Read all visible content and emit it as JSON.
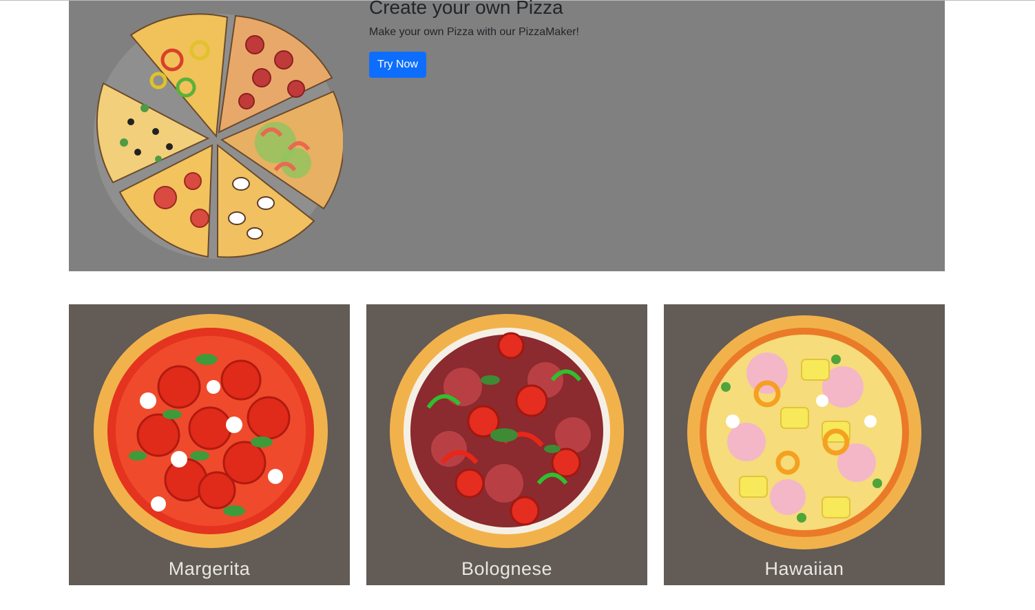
{
  "hero": {
    "title": "Create your own Pizza",
    "subtitle": "Make your own Pizza with our PizzaMaker!",
    "button_label": "Try Now",
    "background_color": "#808080",
    "button_color": "#0d6efd"
  },
  "pizzas": [
    {
      "label": "Margerita",
      "icon": "margherita-pizza-icon"
    },
    {
      "label": "Bolognese",
      "icon": "bolognese-pizza-icon"
    },
    {
      "label": "Hawaiian",
      "icon": "hawaiian-pizza-icon"
    }
  ],
  "colors": {
    "card_background": "#625b56",
    "crust": "#f2b24b",
    "sauce": "#e4331f"
  }
}
